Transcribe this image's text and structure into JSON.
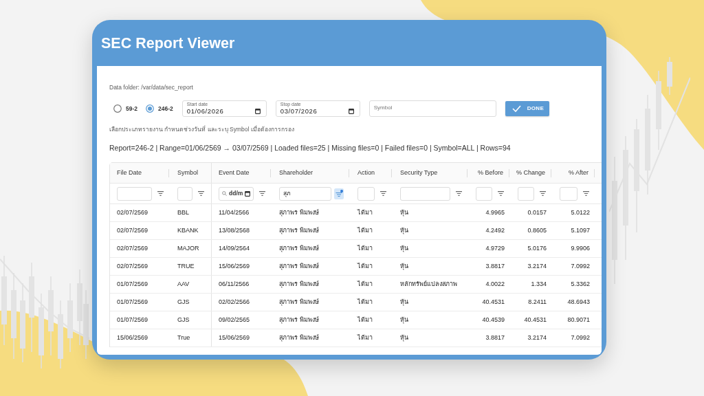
{
  "window": {
    "title": "SEC Report Viewer"
  },
  "data_folder": "Data folder: /var/data/sec_report",
  "report_types": [
    {
      "label": "59-2",
      "selected": false
    },
    {
      "label": "246-2",
      "selected": true
    }
  ],
  "date_fields": [
    {
      "label": "Start date",
      "value": "01/06/2026"
    },
    {
      "label": "Stop date",
      "value": "03/07/2026"
    }
  ],
  "symbol_field": {
    "placeholder": "Symbol"
  },
  "done_button": {
    "label": "DONE"
  },
  "hint": "เลือกประเภทรายงาน กำหนดช่วงวันที่ และระบุ Symbol เมื่อต้องการกรอง",
  "summary": "Report=246-2 | Range=01/06/2569 → 03/07/2569 | Loaded files=25 | Missing files=0 | Failed files=0 | Symbol=ALL | Rows=94",
  "table": {
    "columns": [
      {
        "label": "File Date",
        "numeric": false,
        "filter": {
          "kind": "text",
          "active": false
        }
      },
      {
        "label": "Symbol",
        "numeric": false,
        "filter": {
          "kind": "text",
          "active": false
        }
      },
      {
        "label": "Event Date",
        "numeric": false,
        "filter": {
          "kind": "date",
          "placeholder": "dd/m",
          "active": false
        }
      },
      {
        "label": "Shareholder",
        "numeric": false,
        "filter": {
          "kind": "text",
          "value": "สุภ",
          "active": true
        }
      },
      {
        "label": "Action",
        "numeric": false,
        "filter": {
          "kind": "text",
          "active": false
        }
      },
      {
        "label": "Security Type",
        "numeric": false,
        "filter": {
          "kind": "text",
          "active": false
        }
      },
      {
        "label": "% Before",
        "numeric": true,
        "filter": {
          "kind": "text",
          "active": false
        }
      },
      {
        "label": "% Change",
        "numeric": true,
        "filter": {
          "kind": "text",
          "active": false
        }
      },
      {
        "label": "% After",
        "numeric": true,
        "filter": {
          "kind": "text",
          "active": false
        }
      }
    ],
    "rows": [
      [
        "02/07/2569",
        "BBL",
        "11/04/2566",
        "สุภาพร พิมพงษ์",
        "ได้มา",
        "หุ้น",
        "4.9965",
        "0.0157",
        "5.0122"
      ],
      [
        "02/07/2569",
        "KBANK",
        "13/08/2568",
        "สุภาพร พิมพงษ์",
        "ได้มา",
        "หุ้น",
        "4.2492",
        "0.8605",
        "5.1097"
      ],
      [
        "02/07/2569",
        "MAJOR",
        "14/09/2564",
        "สุภาพร พิมพงษ์",
        "ได้มา",
        "หุ้น",
        "4.9729",
        "5.0176",
        "9.9906"
      ],
      [
        "02/07/2569",
        "TRUE",
        "15/06/2569",
        "สุภาพร พิมพงษ์",
        "ได้มา",
        "หุ้น",
        "3.8817",
        "3.2174",
        "7.0992"
      ],
      [
        "01/07/2569",
        "AAV",
        "06/11/2566",
        "สุภาพร พิมพงษ์",
        "ได้มา",
        "หลักทรัพย์แปลงสภาพ",
        "4.0022",
        "1.334",
        "5.3362"
      ],
      [
        "01/07/2569",
        "GJS",
        "02/02/2566",
        "สุภาพร พิมพงษ์",
        "ได้มา",
        "หุ้น",
        "40.4531",
        "8.2411",
        "48.6943"
      ],
      [
        "01/07/2569",
        "GJS",
        "09/02/2565",
        "สุภาพร พิมพงษ์",
        "ได้มา",
        "หุ้น",
        "40.4539",
        "40.4531",
        "80.9071"
      ],
      [
        "15/06/2569",
        "True",
        "15/06/2569",
        "สุภาพร พิมพงษ์",
        "ได้มา",
        "หุ้น",
        "3.8817",
        "3.2174",
        "7.0992"
      ]
    ]
  }
}
